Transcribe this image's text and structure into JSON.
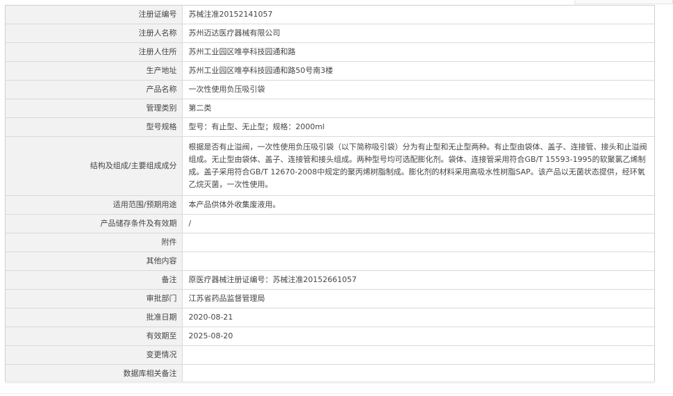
{
  "rows": [
    {
      "label": "注册证编号",
      "value": "苏械注准20152141057"
    },
    {
      "label": "注册人名称",
      "value": "苏州迈达医疗器械有限公司"
    },
    {
      "label": "注册人住所",
      "value": "苏州工业园区唯亭科技园通和路"
    },
    {
      "label": "生产地址",
      "value": "苏州工业园区唯亭科技园通和路50号南3楼"
    },
    {
      "label": "产品名称",
      "value": "一次性使用负压吸引袋"
    },
    {
      "label": "管理类别",
      "value": "第二类"
    },
    {
      "label": "型号规格",
      "value": "型号：有止型、无止型；规格：2000ml"
    },
    {
      "label": "结构及组成/主要组成成分",
      "value": "根据是否有止溢阀，一次性使用负压吸引袋（以下简称吸引袋）分为有止型和无止型两种。有止型由袋体、盖子、连接管、接头和止溢阀组成。无止型由袋体、盖子、连接管和接头组成。两种型号均可选配膨化剂。袋体、连接管采用符合GB/T 15593-1995的软聚氯乙烯制成。盖子采用符合GB/T 12670-2008中规定的聚丙烯树脂制成。膨化剂的材料采用高吸水性树脂SAP。该产品以无菌状态提供，经环氧乙烷灭菌，一次性使用。"
    },
    {
      "label": "适用范围/预期用途",
      "value": "本产品供体外收集废液用。"
    },
    {
      "label": "产品储存条件及有效期",
      "value": "/"
    },
    {
      "label": "附件",
      "value": ""
    },
    {
      "label": "其他内容",
      "value": ""
    },
    {
      "label": "备注",
      "value": "原医疗器械注册证编号：苏械注准20152661057"
    },
    {
      "label": "审批部门",
      "value": "江苏省药品监督管理局"
    },
    {
      "label": "批准日期",
      "value": "2020-08-21"
    },
    {
      "label": "有效期至",
      "value": "2025-08-20"
    },
    {
      "label": "变更情况",
      "value": ""
    },
    {
      "label": "数据库相关备注",
      "value": ""
    }
  ]
}
